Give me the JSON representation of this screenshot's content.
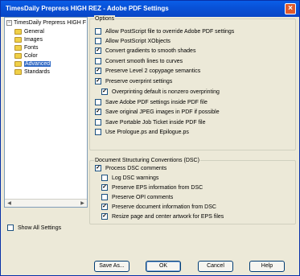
{
  "window": {
    "title": "TimesDaily Prepress HIGH REZ - Adobe PDF Settings",
    "close_label": "×"
  },
  "tree": {
    "root_label": "TimesDaily Prepress HIGH F",
    "items": [
      {
        "label": "General"
      },
      {
        "label": "Images"
      },
      {
        "label": "Fonts"
      },
      {
        "label": "Color"
      },
      {
        "label": "Advanced",
        "selected": true
      },
      {
        "label": "Standards"
      }
    ]
  },
  "show_all": {
    "label": "Show All Settings",
    "checked": false
  },
  "options": {
    "title": "Options",
    "items": [
      {
        "label": "Allow PostScript file to override Adobe PDF settings",
        "checked": false
      },
      {
        "label": "Allow PostScript XObjects",
        "checked": false
      },
      {
        "label": "Convert gradients to smooth shades",
        "checked": true
      },
      {
        "label": "Convert smooth lines to curves",
        "checked": false
      },
      {
        "label": "Preserve Level 2 copypage semantics",
        "checked": true
      },
      {
        "label": "Preserve overprint settings",
        "checked": true
      },
      {
        "label": "Overprinting default is nonzero overprinting",
        "checked": true
      },
      {
        "label": "Save Adobe PDF settings inside PDF file",
        "checked": false
      },
      {
        "label": "Save original JPEG images in PDF if possible",
        "checked": true
      },
      {
        "label": "Save Portable Job Ticket inside PDF file",
        "checked": false
      },
      {
        "label": "Use Prologue.ps and Epilogue.ps",
        "checked": false
      }
    ]
  },
  "dsc": {
    "title": "Document Structuring Conventions (DSC)",
    "items": [
      {
        "label": "Process DSC comments",
        "checked": true
      },
      {
        "label": "Log DSC warnings",
        "checked": false
      },
      {
        "label": "Preserve EPS information from DSC",
        "checked": true
      },
      {
        "label": "Preserve OPI comments",
        "checked": false
      },
      {
        "label": "Preserve document information from DSC",
        "checked": true
      },
      {
        "label": "Resize page and center artwork for EPS files",
        "checked": true
      }
    ]
  },
  "buttons": {
    "save_as": "Save As...",
    "ok": "OK",
    "cancel": "Cancel",
    "help": "Help"
  },
  "check_mark": "✓"
}
